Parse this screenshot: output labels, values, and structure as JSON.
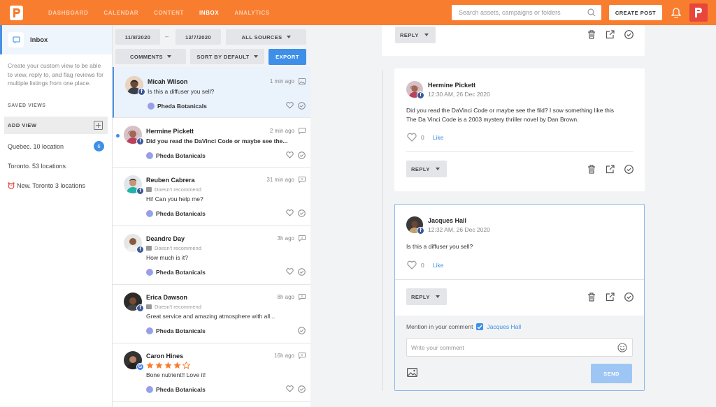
{
  "topbar": {
    "nav": [
      "DASHBOARD",
      "CALENDAR",
      "CONTENT",
      "INBOX",
      "ANALYTICS"
    ],
    "active_nav": "INBOX",
    "search_placeholder": "Search assets, campaigns or folders",
    "create_post": "CREATE POST",
    "accent": "#f97d2e"
  },
  "sidebar": {
    "inbox_label": "Inbox",
    "description": "Create your custom view to be able to view, reply to, and flag reviews for multiple listings from one place.",
    "saved_views_title": "SAVED VIEWS",
    "add_view": "ADD VIEW",
    "views": [
      {
        "label": "Quebec. 10 location",
        "badge": "6"
      },
      {
        "label": "Toronto. 53 locations"
      },
      {
        "label": "New. Toronto 3 locations",
        "icon": "alarm-clock-icon"
      }
    ]
  },
  "filters": {
    "date_from": "11/8/2020",
    "date_sep": "–",
    "date_to": "12/7/2020",
    "sources": "ALL SOURCES",
    "type": "COMMENTS",
    "sort": "SORT BY DEFAULT",
    "export": "EXPORT"
  },
  "list": [
    {
      "name": "Micah Wilson",
      "time": "1 min ago",
      "text": "Is this a diffuser you sell?",
      "brand": "Pheda Botanicals",
      "source": "facebook",
      "type_icon": "image-icon",
      "selected": true
    },
    {
      "name": "Hermine Pickett",
      "time": "2 min ago",
      "text": "Did you read the DaVinci Code or maybe see the...",
      "brand": "Pheda Botanicals",
      "source": "facebook",
      "unread": true
    },
    {
      "name": "Reuben Cabrera",
      "time": "31 min ago",
      "status": "Doesn't recommend",
      "text": "Hi! Can you help me?",
      "brand": "Pheda Botanicals",
      "source": "facebook"
    },
    {
      "name": "Deandre Day",
      "time": "3h ago",
      "status": "Doesn't recommend",
      "text": "How much is it?",
      "brand": "Pheda Botanicals",
      "source": "facebook"
    },
    {
      "name": "Erica Dawson",
      "time": "8h ago",
      "status": "Doesn't recommend",
      "text": "Great service and amazing atmosphere  with all...",
      "brand": "Pheda Botanicals",
      "source": "facebook"
    },
    {
      "name": "Caron Hines",
      "time": "16h ago",
      "rating": 4,
      "text": "Bone nutrient!! Love it!",
      "brand": "Pheda Botanicals",
      "source": "google"
    }
  ],
  "detail": {
    "reply": "REPLY",
    "like": "Like",
    "posts": [
      {
        "name": "Hermine Pickett",
        "time": "12:30 AM, 26 Dec 2020",
        "text_line1": "Did you read the DaVinci Code or maybe see the fild? I sow something like this",
        "text_line2": "The Da Vinci Code is a 2003 mystery thriller novel by Dan Brown.",
        "likes": "0"
      },
      {
        "name": "Jacques Hall",
        "time": "12:32 AM, 26 Dec 2020",
        "text_line1": "Is this a diffuser you sell?",
        "likes": "0"
      }
    ],
    "mention_label": "Mention in your comment",
    "mention_name": "Jacques Hall",
    "comment_placeholder": "Write your comment",
    "send": "SEND"
  }
}
